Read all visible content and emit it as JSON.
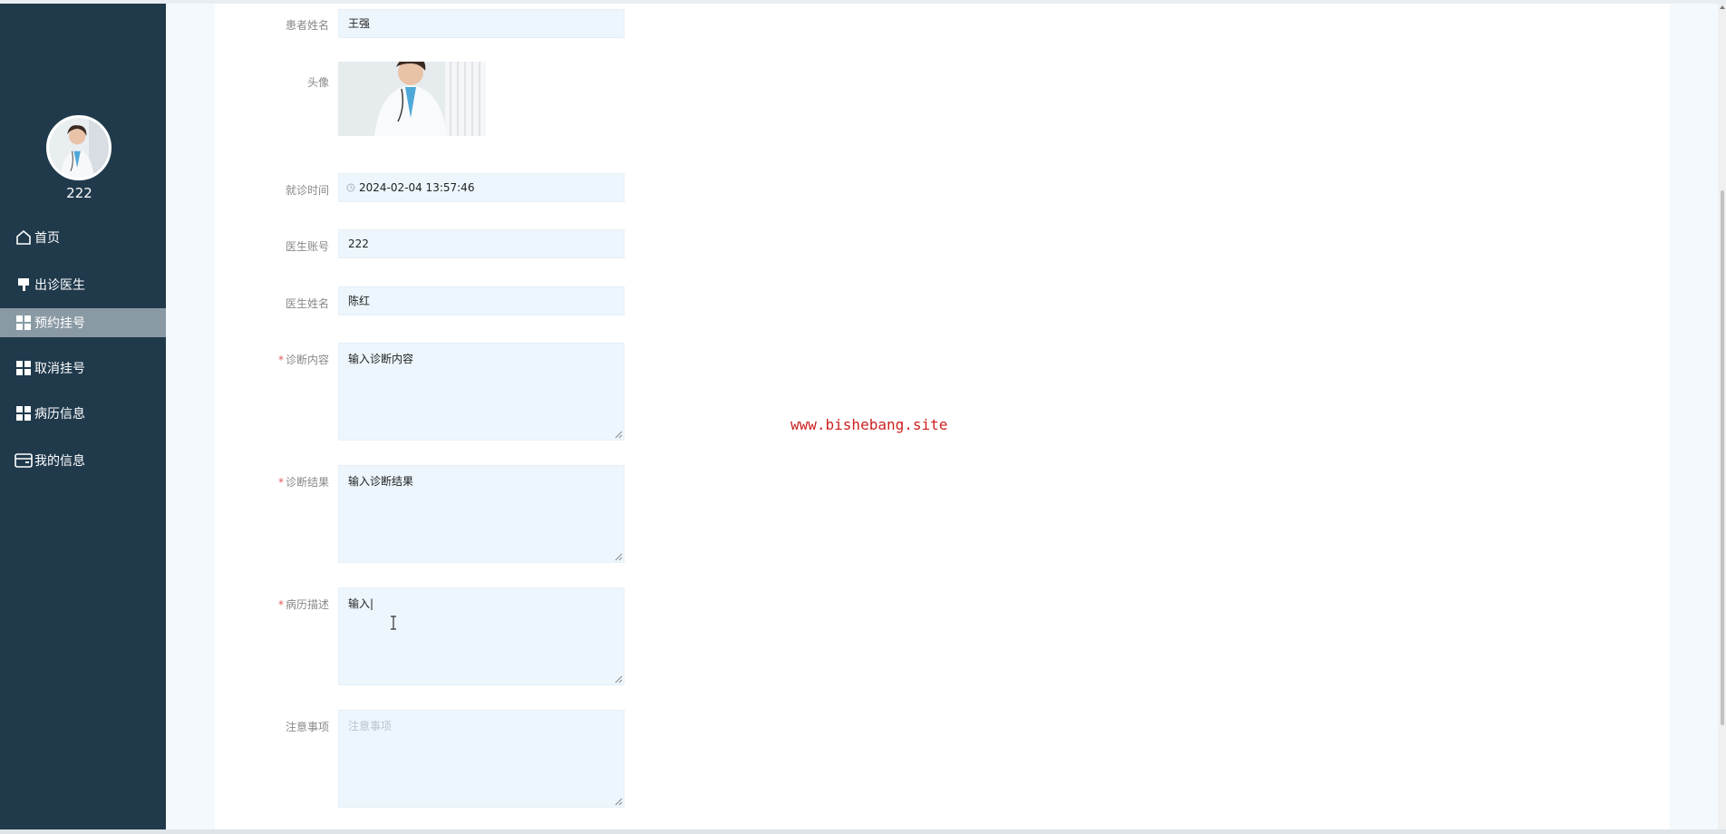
{
  "sidebar": {
    "username": "222",
    "items": [
      {
        "label": "首页",
        "icon": "home-icon"
      },
      {
        "label": "出诊医生",
        "icon": "pin-icon"
      },
      {
        "label": "预约挂号",
        "icon": "grid-icon",
        "active": true
      },
      {
        "label": "取消挂号",
        "icon": "grid-icon"
      },
      {
        "label": "病历信息",
        "icon": "grid-icon"
      },
      {
        "label": "我的信息",
        "icon": "card-icon"
      }
    ]
  },
  "form": {
    "patient_name": {
      "label": "患者姓名",
      "value": "王强"
    },
    "avatar": {
      "label": "头像"
    },
    "visit_time": {
      "label": "就诊时间",
      "value": "2024-02-04 13:57:46"
    },
    "doctor_account": {
      "label": "医生账号",
      "value": "222"
    },
    "doctor_name": {
      "label": "医生姓名",
      "value": "陈红"
    },
    "diagnosis_content": {
      "label": "诊断内容",
      "required_mark": "*",
      "value": "输入诊断内容"
    },
    "diagnosis_result": {
      "label": "诊断结果",
      "required_mark": "*",
      "value": "输入诊断结果"
    },
    "case_description": {
      "label": "病历描述",
      "required_mark": "*",
      "value": "输入|"
    },
    "notes": {
      "label": "注意事项",
      "placeholder": "注意事项",
      "value": ""
    }
  },
  "watermark": "www.bishebang.site",
  "colors": {
    "sidebar_bg": "#203a4c",
    "sidebar_active": "#8a9aa4",
    "field_bg": "#ecf6fc",
    "required": "#e05a5a",
    "watermark": "#cc2020"
  }
}
